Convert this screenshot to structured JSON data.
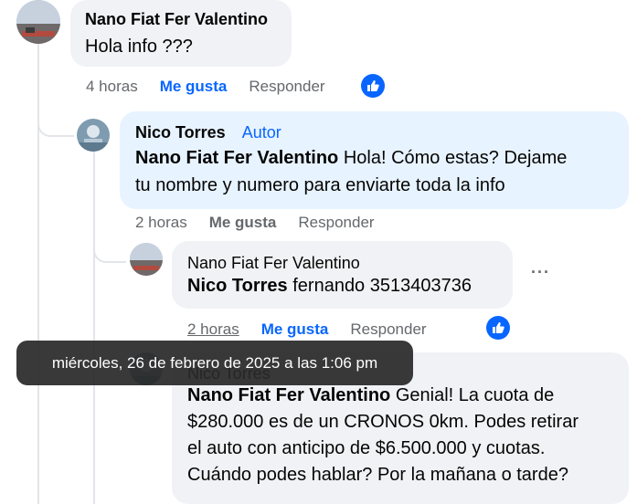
{
  "comments": [
    {
      "author": "Nano Fiat Fer Valentino",
      "text": "Hola info ???",
      "time": "4 horas",
      "like_label": "Me gusta",
      "reply_label": "Responder"
    },
    {
      "author": "Nico Torres",
      "badge": "Autor",
      "mention": "Nano Fiat Fer Valentino",
      "text_line1": " Hola! Cómo estas? Dejame",
      "text_line2": "tu nombre y numero para enviarte toda la info",
      "time": "2 horas",
      "like_label": "Me gusta",
      "reply_label": "Responder"
    },
    {
      "author": "Nano Fiat Fer Valentino",
      "mention": "Nico Torres",
      "text": " fernando 3513403736",
      "time": "2 horas",
      "like_label": "Me gusta",
      "reply_label": "Responder",
      "more": "···"
    },
    {
      "author": "Nico Torres",
      "mention": "Nano Fiat Fer Valentino",
      "text_line1": " Genial! La cuota de",
      "text_line2": "$280.000 es de un CRONOS 0km. Podes retirar",
      "text_line3": "el auto con anticipo de $6.500.000 y cuotas.",
      "text_line4": "Cuándo podes hablar? Por la mañana o tarde?"
    }
  ],
  "tooltip": "miércoles, 26 de febrero de 2025 a las 1:06 pm",
  "colors": {
    "accent": "#0866ff",
    "bubble_gray": "#f0f2f5",
    "bubble_blue": "#e7f3ff",
    "meta_text": "#65686c"
  }
}
